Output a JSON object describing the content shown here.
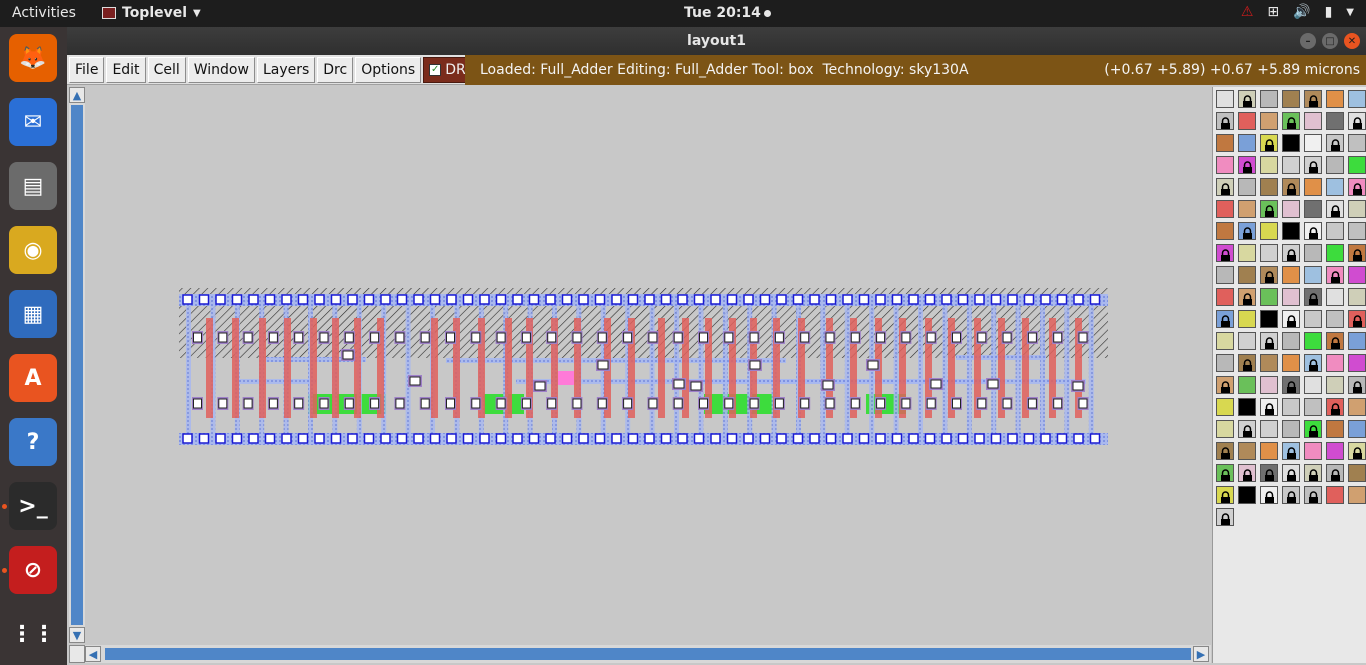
{
  "topbar": {
    "activities": "Activities",
    "app_name": "Toplevel",
    "clock": "Tue 20:14"
  },
  "dock": {
    "items": [
      {
        "name": "firefox-icon",
        "color": "#e66000"
      },
      {
        "name": "thunderbird-icon",
        "color": "#2a6fd6"
      },
      {
        "name": "files-icon",
        "color": "#6b6b6b"
      },
      {
        "name": "rhythmbox-icon",
        "color": "#d9a91f"
      },
      {
        "name": "libreoffice-writer-icon",
        "color": "#2f6bbd"
      },
      {
        "name": "software-center-icon",
        "color": "#e95420"
      },
      {
        "name": "help-icon",
        "color": "#3a78c8"
      },
      {
        "name": "terminal-icon",
        "color": "#2b2b2b"
      },
      {
        "name": "no-entry-icon",
        "color": "#c41e1e"
      },
      {
        "name": "app-grid-icon",
        "color": "#3a3434"
      }
    ]
  },
  "window": {
    "title": "layout1",
    "menus": [
      "File",
      "Edit",
      "Cell",
      "Window",
      "Layers",
      "Drc",
      "Options"
    ],
    "drc_label": "DRC",
    "status_message": "Loaded: Full_Adder Editing: Full_Adder Tool: box  Technology: sky130A",
    "coordinates": "(+0.67 +5.89) +0.67 +5.89 microns"
  },
  "colors": {
    "status_bar": "#7c5415",
    "drc_button": "#7a2c1c",
    "canvas_bg": "#c8c8c8",
    "poly": "#e0605c",
    "diffusion": "#3ddc3d",
    "metal1": "#a8b8f0",
    "local_interconnect": "#9e80c8",
    "nwell_hatch": "#2a2a2a",
    "scrollbar": "#4f86c8"
  }
}
